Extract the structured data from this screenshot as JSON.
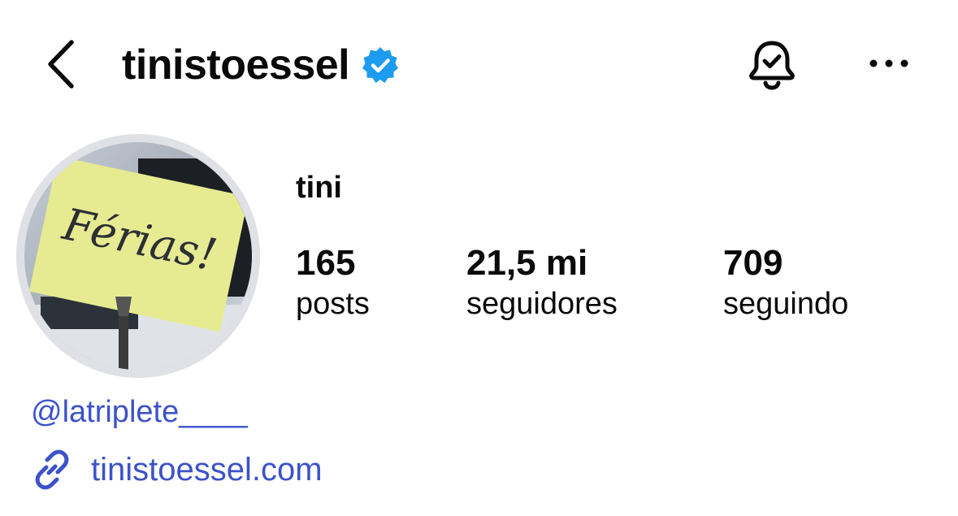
{
  "header": {
    "username": "tinistoessel",
    "back_icon": "chevron-left-icon",
    "verified_icon": "verified-badge-icon",
    "notification_icon": "bell-check-icon",
    "more_icon": "more-horizontal-icon"
  },
  "profile": {
    "display_name": "tini",
    "avatar_text": "Férias!",
    "stats": [
      {
        "value": "165",
        "label": "posts"
      },
      {
        "value": "21,5 mi",
        "label": "seguidores"
      },
      {
        "value": "709",
        "label": "seguindo"
      }
    ],
    "mention": "@latriplete____",
    "link": "tinistoessel.com",
    "link_icon": "link-icon"
  },
  "colors": {
    "link_blue": "#3d52c9",
    "verified_blue": "#1d9bf0",
    "sticky_note": "#e6eb92"
  }
}
